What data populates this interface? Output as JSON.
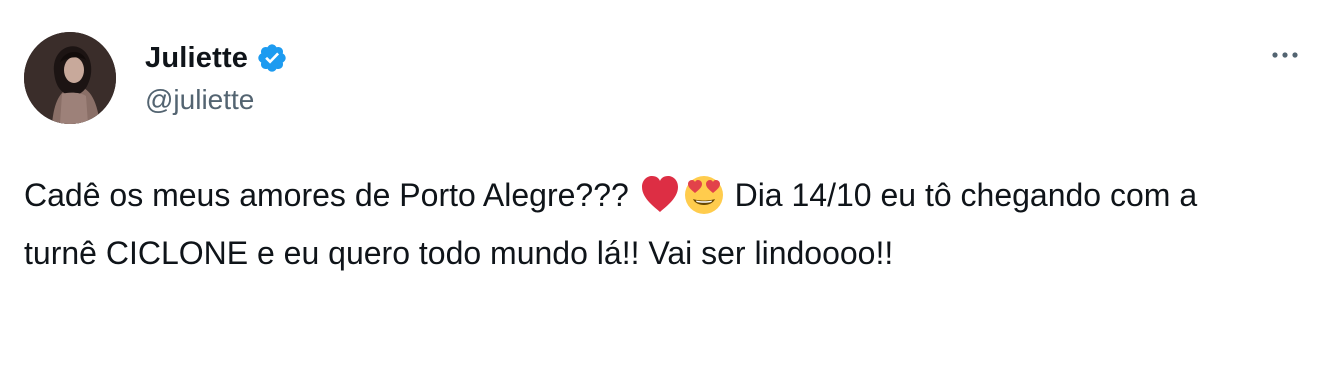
{
  "author": {
    "display_name": "Juliette",
    "handle": "@juliette",
    "verified_icon": "verified-badge-icon",
    "avatar_icon": "profile-photo"
  },
  "more_button": {
    "icon": "more-horizontal-icon"
  },
  "tweet": {
    "text_part_1": "Cadê os meus amores de Porto Alegre??? ",
    "emoji_1": "red-heart-emoji",
    "emoji_2": "heart-eyes-emoji",
    "text_part_2": " Dia 14/10 eu tô chegando com a turnê CICLONE e eu quero todo mundo lá!! Vai ser lindoooo!!"
  },
  "colors": {
    "text_primary": "#0f1419",
    "text_secondary": "#536471",
    "verified_blue": "#1d9bf0"
  }
}
